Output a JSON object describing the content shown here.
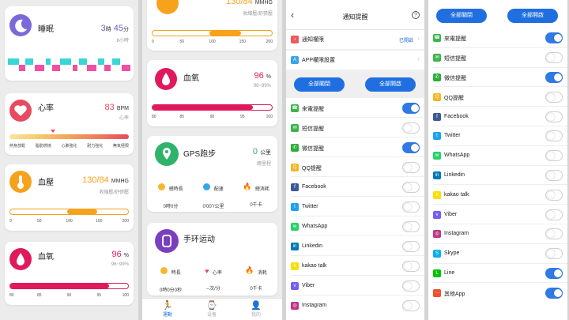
{
  "panel1": {
    "sleep": {
      "title": "睡眠",
      "hours": "3",
      "hour_unit": "時",
      "minutes": "45",
      "minute_unit": "分",
      "goal": "8小時"
    },
    "heart": {
      "title": "心率",
      "value": "83",
      "unit": "BPM",
      "sub": "心率",
      "marker_pct": 0.34,
      "zones": [
        "熱身放鬆",
        "脂肪燃燒",
        "心肺強化",
        "耐力強化",
        "無氧極限"
      ]
    },
    "bp": {
      "title": "血壓",
      "value": "130/84",
      "unit": "MMHG",
      "sub": "收縮壓/舒張壓",
      "range_start": 0.48,
      "range_end": 0.74,
      "ticks": [
        "0",
        "50",
        "100",
        "150",
        "200"
      ]
    },
    "spo2": {
      "title": "血氧",
      "value": "96",
      "unit": "%",
      "sub": "96~99%",
      "fill": 0.84,
      "ticks": [
        "80",
        "85",
        "90",
        "95",
        "100"
      ]
    }
  },
  "panel2": {
    "bp_top": {
      "value": "130/84",
      "unit": "MMHG",
      "sub": "收縮壓/舒張壓",
      "range_start": 0.48,
      "range_end": 0.74,
      "ticks": [
        "0",
        "50",
        "100",
        "150",
        "200"
      ]
    },
    "spo2": {
      "title": "血氧",
      "value": "96",
      "unit": "%",
      "sub": "96~99%",
      "fill": 0.84,
      "ticks": [
        "80",
        "85",
        "90",
        "95",
        "100"
      ]
    },
    "gps": {
      "title": "GPS跑步",
      "value": "0",
      "unit": "公里",
      "sub": "總里程",
      "stats": [
        {
          "label": "總時長",
          "value": "0時0分"
        },
        {
          "label": "配速",
          "value": "0'00\"/公里"
        },
        {
          "label": "總消耗",
          "value": "0千卡"
        }
      ]
    },
    "band": {
      "title": "手环运动",
      "stats": [
        {
          "label": "時長",
          "value": "0時0分0秒"
        },
        {
          "label": "心率",
          "value": "--次/分"
        },
        {
          "label": "消耗",
          "value": "0千卡"
        }
      ]
    },
    "nav": [
      {
        "label": "運動",
        "icon": "🏃"
      },
      {
        "label": "设备",
        "icon": "⌚"
      },
      {
        "label": "我的",
        "icon": "👤"
      }
    ]
  },
  "panel3": {
    "title": "通知提醒",
    "back_icon": "back-arrow",
    "help_icon": "?",
    "notify_perm": {
      "label": "通知權限",
      "status": "已開啟"
    },
    "app_perm": {
      "label": "APP權限設置"
    },
    "btn_off": "全部關閉",
    "btn_on": "全部開啟",
    "apps": [
      {
        "name": "來電提醒",
        "on": true,
        "color": "#3bb54a",
        "glyph": "☎"
      },
      {
        "name": "短信提醒",
        "on": false,
        "color": "#3bb54a",
        "glyph": "✉"
      },
      {
        "name": "微信提醒",
        "on": true,
        "color": "#2aae38",
        "glyph": "✆"
      },
      {
        "name": "QQ提醒",
        "on": false,
        "color": "#f3b622",
        "glyph": "Q"
      },
      {
        "name": "Facebook",
        "on": false,
        "color": "#3b5998",
        "glyph": "f"
      },
      {
        "name": "Twitter",
        "on": false,
        "color": "#1da1f2",
        "glyph": "t"
      },
      {
        "name": "WhatsApp",
        "on": false,
        "color": "#25d366",
        "glyph": "w"
      },
      {
        "name": "Linkedin",
        "on": false,
        "color": "#0077b5",
        "glyph": "in"
      },
      {
        "name": "kakao talk",
        "on": false,
        "color": "#f9e000",
        "glyph": "k"
      },
      {
        "name": "Viber",
        "on": false,
        "color": "#7360f2",
        "glyph": "v"
      },
      {
        "name": "Instagram",
        "on": false,
        "color": "#c13584",
        "glyph": "◎"
      }
    ]
  },
  "panel4": {
    "btn_off": "全部關閉",
    "btn_on": "全部開啟",
    "apps": [
      {
        "name": "來電提醒",
        "on": true,
        "color": "#3bb54a",
        "glyph": "☎"
      },
      {
        "name": "短信提醒",
        "on": false,
        "color": "#3bb54a",
        "glyph": "✉"
      },
      {
        "name": "微信提醒",
        "on": true,
        "color": "#2aae38",
        "glyph": "✆"
      },
      {
        "name": "QQ提醒",
        "on": false,
        "color": "#f3b622",
        "glyph": "Q"
      },
      {
        "name": "Facebook",
        "on": false,
        "color": "#3b5998",
        "glyph": "f"
      },
      {
        "name": "Twitter",
        "on": false,
        "color": "#1da1f2",
        "glyph": "t"
      },
      {
        "name": "WhatsApp",
        "on": false,
        "color": "#25d366",
        "glyph": "w"
      },
      {
        "name": "Linkedin",
        "on": false,
        "color": "#0077b5",
        "glyph": "in"
      },
      {
        "name": "kakao talk",
        "on": false,
        "color": "#f9e000",
        "glyph": "k"
      },
      {
        "name": "Viber",
        "on": false,
        "color": "#7360f2",
        "glyph": "v"
      },
      {
        "name": "Instagram",
        "on": false,
        "color": "#c13584",
        "glyph": "◎"
      },
      {
        "name": "Skype",
        "on": false,
        "color": "#00aff0",
        "glyph": "S"
      },
      {
        "name": "Line",
        "on": true,
        "color": "#00c300",
        "glyph": "L"
      },
      {
        "name": "其他App",
        "on": true,
        "color": "#f04e30",
        "glyph": "⋯"
      }
    ]
  },
  "colors": {
    "accent": "#1f6fe0",
    "heart": "#e84a5f",
    "bp": "#f7a21b",
    "spo2": "#e0195d",
    "gps": "#2fb36b",
    "band": "#7a3fbf"
  }
}
